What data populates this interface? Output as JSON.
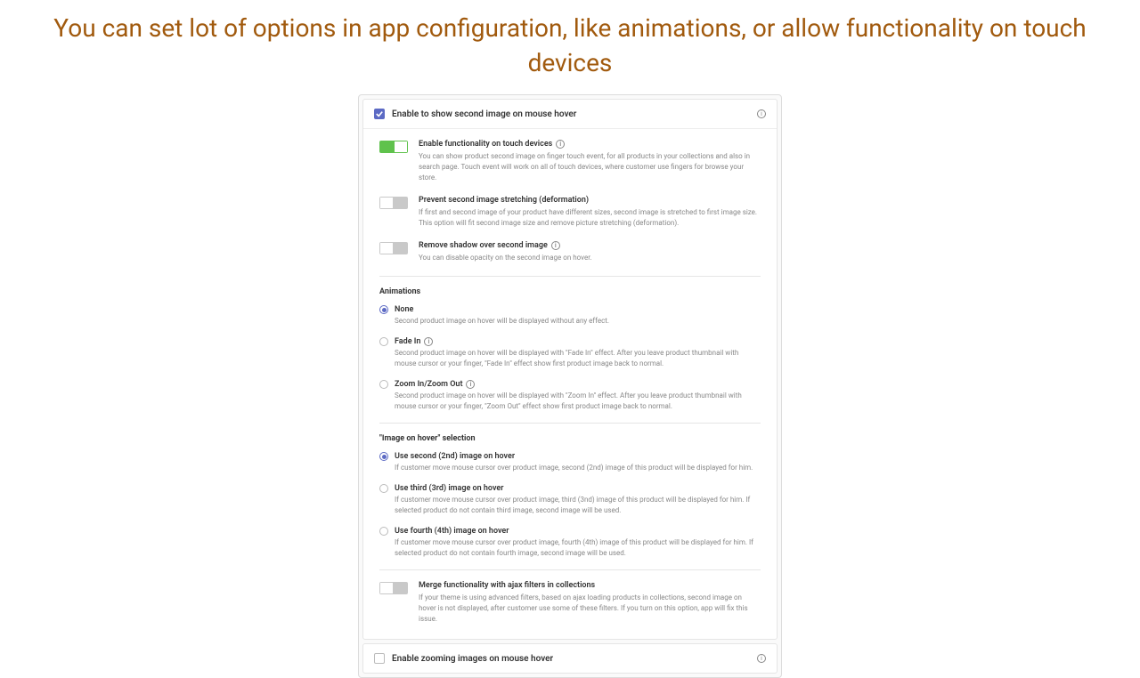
{
  "headline": "You can set lot of options in app configuration, like animations, or allow functionality on touch devices",
  "card1": {
    "title": "Enable to show second image on mouse hover",
    "toggles": [
      {
        "on": true,
        "label": "Enable functionality on touch devices",
        "info": true,
        "desc": "You can show product second image on finger touch event, for all products in your collections and also in search page. Touch event will work on all of touch devices, where customer use fingers for browse your store."
      },
      {
        "on": false,
        "label": "Prevent second image stretching (deformation)",
        "info": false,
        "desc": "If first and second image of your product have different sizes, second image is stretched to first image size. This option will fit second image size and remove picture stretching (deformation)."
      },
      {
        "on": false,
        "label": "Remove shadow over second image",
        "info": true,
        "desc": "You can disable opacity on the second image on hover."
      }
    ],
    "animations": {
      "title": "Animations",
      "options": [
        {
          "checked": true,
          "label": "None",
          "info": false,
          "desc": "Second product image on hover will be displayed without any effect."
        },
        {
          "checked": false,
          "label": "Fade In",
          "info": true,
          "desc": "Second product image on hover will be displayed with \"Fade In\" effect. After you leave product thumbnail with mouse cursor or your finger, \"Fade In\" effect show first product image back to normal."
        },
        {
          "checked": false,
          "label": "Zoom In/Zoom Out",
          "info": true,
          "desc": "Second product image on hover will be displayed with \"Zoom In\" effect. After you leave product thumbnail with mouse cursor or your finger, \"Zoom Out\" effect show first product image back to normal."
        }
      ]
    },
    "selection": {
      "title": "\"Image on hover\" selection",
      "options": [
        {
          "checked": true,
          "label": "Use second (2nd) image on hover",
          "desc": "If customer move mouse cursor over product image, second (2nd) image of this product will be displayed for him."
        },
        {
          "checked": false,
          "label": "Use third (3rd) image on hover",
          "desc": "If customer move mouse cursor over product image, third (3nd) image of this product will be displayed for him. If selected product do not contain third image, second image will be used."
        },
        {
          "checked": false,
          "label": "Use fourth (4th) image on hover",
          "desc": "If customer move mouse cursor over product image, fourth (4th) image of this product will be displayed for him. If selected product do not contain fourth image, second image will be used."
        }
      ]
    },
    "merge": {
      "on": false,
      "label": "Merge functionality with ajax filters in collections",
      "desc": "If your theme is using advanced filters, based on ajax loading products in collections, second image on hover is not displayed, after customer use some of these filters. If you turn on this option, app will fix this issue."
    }
  },
  "card2": {
    "title": "Enable zooming images on mouse hover"
  }
}
